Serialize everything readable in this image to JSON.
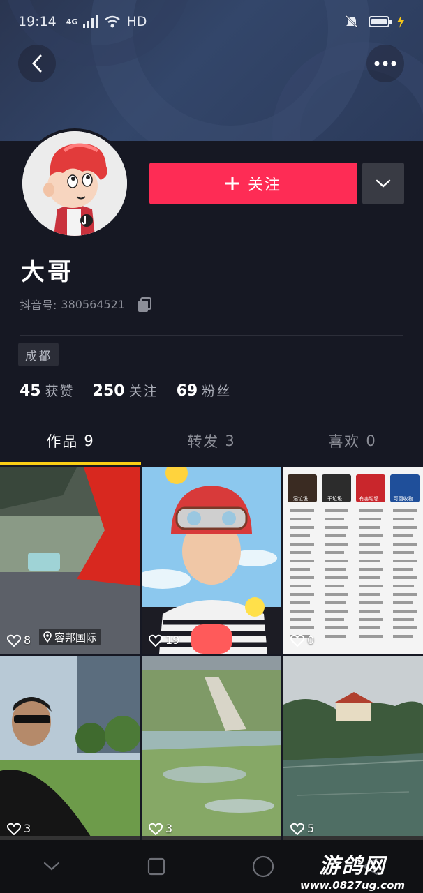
{
  "status_bar": {
    "time": "19:14",
    "network": "4G",
    "hd": "HD",
    "icons": [
      "signal-icon",
      "wifi-icon",
      "mute-icon",
      "battery-icon",
      "charging-icon"
    ]
  },
  "header": {
    "back_icon": "chevron-left-icon",
    "more_icon": "more-dots-icon"
  },
  "profile": {
    "name": "大哥",
    "id_label": "抖音号:",
    "id_value": "380564521",
    "location": "成都",
    "follow_label": "关注",
    "stats": [
      {
        "value": "45",
        "label": "获赞"
      },
      {
        "value": "250",
        "label": "关注"
      },
      {
        "value": "69",
        "label": "粉丝"
      }
    ]
  },
  "tabs": [
    {
      "label": "作品",
      "count": "9",
      "active": true
    },
    {
      "label": "转发",
      "count": "3",
      "active": false
    },
    {
      "label": "喜欢",
      "count": "0",
      "active": false
    }
  ],
  "videos": [
    {
      "likes": "8",
      "location": "容邦国际"
    },
    {
      "likes": "19"
    },
    {
      "likes": "0"
    },
    {
      "likes": "3"
    },
    {
      "likes": "3"
    },
    {
      "likes": "5"
    }
  ],
  "garbage_poster": {
    "headers": [
      "湿垃圾",
      "干垃圾",
      "有害垃圾",
      "可回收物"
    ]
  },
  "watermark": {
    "title": "游鸽网",
    "url": "www.0827ug.com"
  },
  "colors": {
    "background": "#161823",
    "accent": "#fe2c55",
    "tab_indicator": "#face15"
  }
}
